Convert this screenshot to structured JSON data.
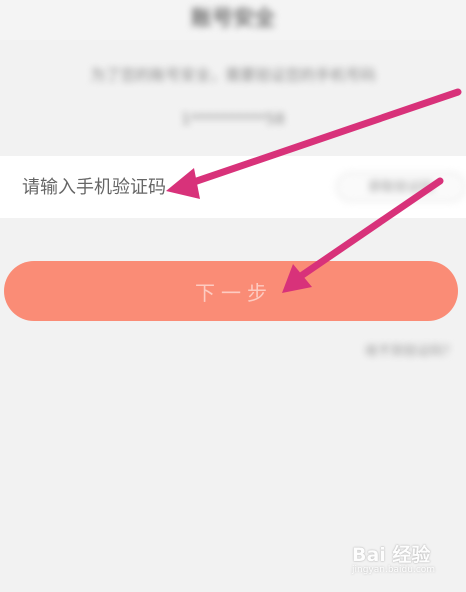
{
  "header": {
    "title": "账号安全"
  },
  "verify": {
    "description_line1": "为了您的账号安全，需要验证您的手机号码",
    "phone_masked": "1**********58"
  },
  "form": {
    "code_placeholder": "请输入手机验证码",
    "code_value": "",
    "resend_label": "获取验证码"
  },
  "actions": {
    "next_label": "下一步",
    "help_link": "收不到验证码？"
  },
  "annotations": {
    "arrow_color": "#d8327a",
    "arrow_count": 2
  },
  "watermark": {
    "logo_text": "Bai 经验",
    "sub_text": "jingyan.baidu.com"
  },
  "colors": {
    "background": "#f2f2f2",
    "button": "#fa8c76",
    "arrow": "#d8327a"
  }
}
